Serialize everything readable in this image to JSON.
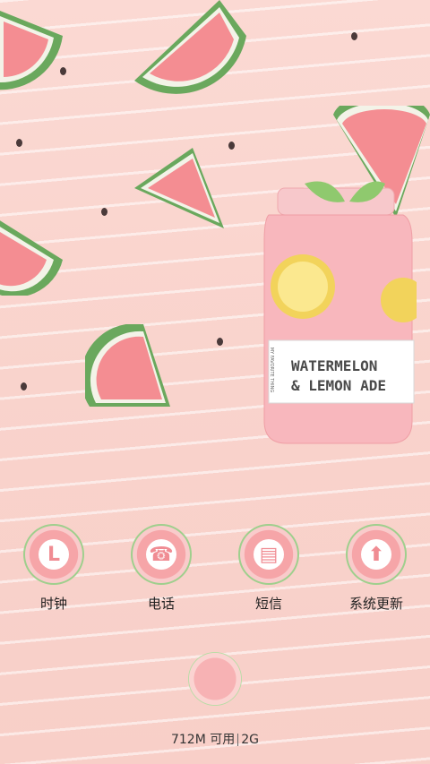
{
  "wallpaper": {
    "jar_label_line1": "WATERMELON",
    "jar_label_line2": "& LEMON ADE",
    "jar_side_text": "MY FAVORITE THING"
  },
  "apps": [
    {
      "label": "时钟",
      "icon": "clock-icon",
      "glyph": "L"
    },
    {
      "label": "电话",
      "icon": "phone-icon",
      "glyph": "☎"
    },
    {
      "label": "短信",
      "icon": "message-icon",
      "glyph": "▤"
    },
    {
      "label": "系统更新",
      "icon": "update-icon",
      "glyph": "⬆"
    }
  ],
  "status": {
    "memory": "712M 可用",
    "network": "2G"
  },
  "colors": {
    "background": "#fbd9d3",
    "watermelon_flesh": "#f6a5a8",
    "rind": "#6aa85d",
    "icon_glyph": "#f08c93"
  }
}
